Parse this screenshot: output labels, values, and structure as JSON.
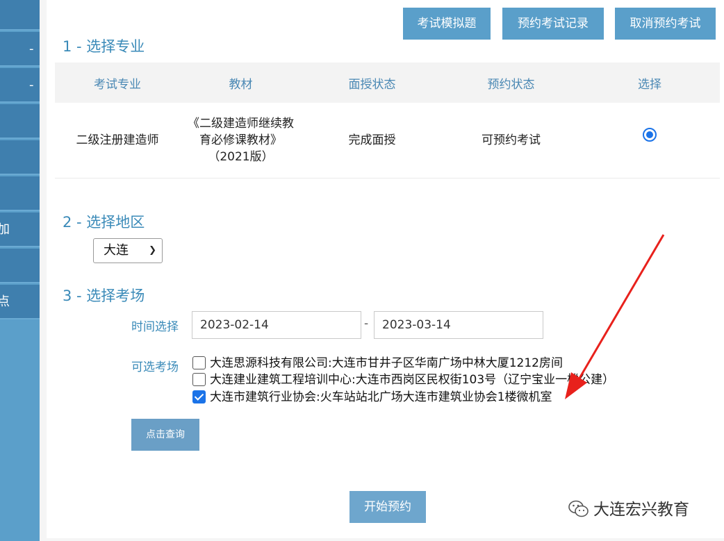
{
  "sidebar": {
    "items": [
      {
        "text": ""
      },
      {
        "text": "-"
      },
      {
        "text": "-"
      },
      {
        "text": ""
      },
      {
        "text": ""
      },
      {
        "text": ""
      },
      {
        "text": "加"
      },
      {
        "text": ""
      },
      {
        "text": "点"
      }
    ]
  },
  "toolbar": {
    "mock_exam": "考试模拟题",
    "booking_records": "预约考试记录",
    "cancel_booking": "取消预约考试"
  },
  "section1": {
    "title": "1 - 选择专业",
    "headers": [
      "考试专业",
      "教材",
      "面授状态",
      "预约状态",
      "选择"
    ],
    "row": {
      "major": "二级注册建造师",
      "textbook_line1": "《二级建造师继续教",
      "textbook_line2": "育必修课教材》",
      "textbook_line3": "（2021版）",
      "lecture_status": "完成面授",
      "booking_status": "可预约考试",
      "selected": true
    }
  },
  "section2": {
    "title": "2 - 选择地区",
    "region": "大连"
  },
  "section3": {
    "title": "3 - 选择考场",
    "time_label": "时间选择",
    "date_from": "2023-02-14",
    "date_sep": "-",
    "date_to": "2023-03-14",
    "venue_label": "可选考场",
    "venues": [
      {
        "label": "大连思源科技有限公司:大连市甘井子区华南广场中林大厦1212房间",
        "checked": false
      },
      {
        "label": "大连建业建筑工程培训中心:大连市西岗区民权街103号（辽宁宝业一楼公建）",
        "checked": false
      },
      {
        "label": "大连市建筑行业协会:火车站站北广场大连市建筑业协会1楼微机室",
        "checked": true
      }
    ],
    "query_button": "点击查询"
  },
  "actions": {
    "start_booking": "开始预约"
  },
  "watermark": {
    "text": "大连宏兴教育"
  },
  "colors": {
    "accent": "#5a9fca",
    "title_blue": "#3a8ab8",
    "checkbox_blue": "#1b73e8",
    "annotation_red": "#e8211c"
  }
}
